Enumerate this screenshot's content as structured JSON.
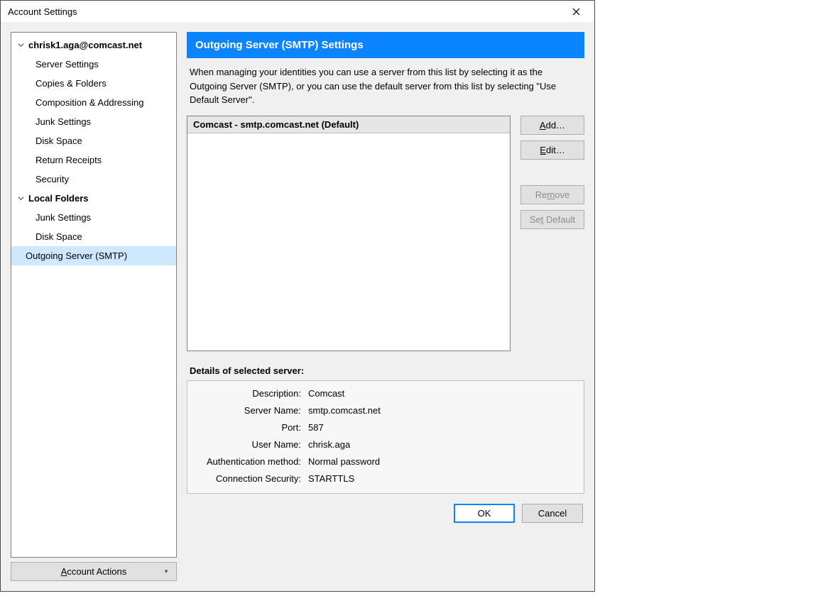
{
  "window": {
    "title": "Account Settings"
  },
  "tree": {
    "account": {
      "label": "chrisk1.aga@comcast.net",
      "children": [
        "Server Settings",
        "Copies & Folders",
        "Composition & Addressing",
        "Junk Settings",
        "Disk Space",
        "Return Receipts",
        "Security"
      ]
    },
    "local": {
      "label": "Local Folders",
      "children": [
        "Junk Settings",
        "Disk Space"
      ]
    },
    "smtp_label": "Outgoing Server (SMTP)",
    "account_actions": "Account Actions"
  },
  "page": {
    "header": "Outgoing Server (SMTP) Settings",
    "intro": "When managing your identities you can use a server from this list by selecting it as the Outgoing Server (SMTP), or you can use the default server from this list by selecting \"Use Default Server\".",
    "list_item": "Comcast - smtp.comcast.net (Default)"
  },
  "buttons": {
    "add": "Add…",
    "edit": "Edit…",
    "remove": "Remove",
    "set_default": "Set Default",
    "ok": "OK",
    "cancel": "Cancel"
  },
  "details": {
    "title": "Details of selected server:",
    "rows": [
      {
        "label": "Description:",
        "value": "Comcast"
      },
      {
        "label": "Server Name:",
        "value": "smtp.comcast.net"
      },
      {
        "label": "Port:",
        "value": "587"
      },
      {
        "label": "User Name:",
        "value": "chrisk.aga"
      },
      {
        "label": "Authentication method:",
        "value": "Normal password"
      },
      {
        "label": "Connection Security:",
        "value": "STARTTLS"
      }
    ]
  }
}
